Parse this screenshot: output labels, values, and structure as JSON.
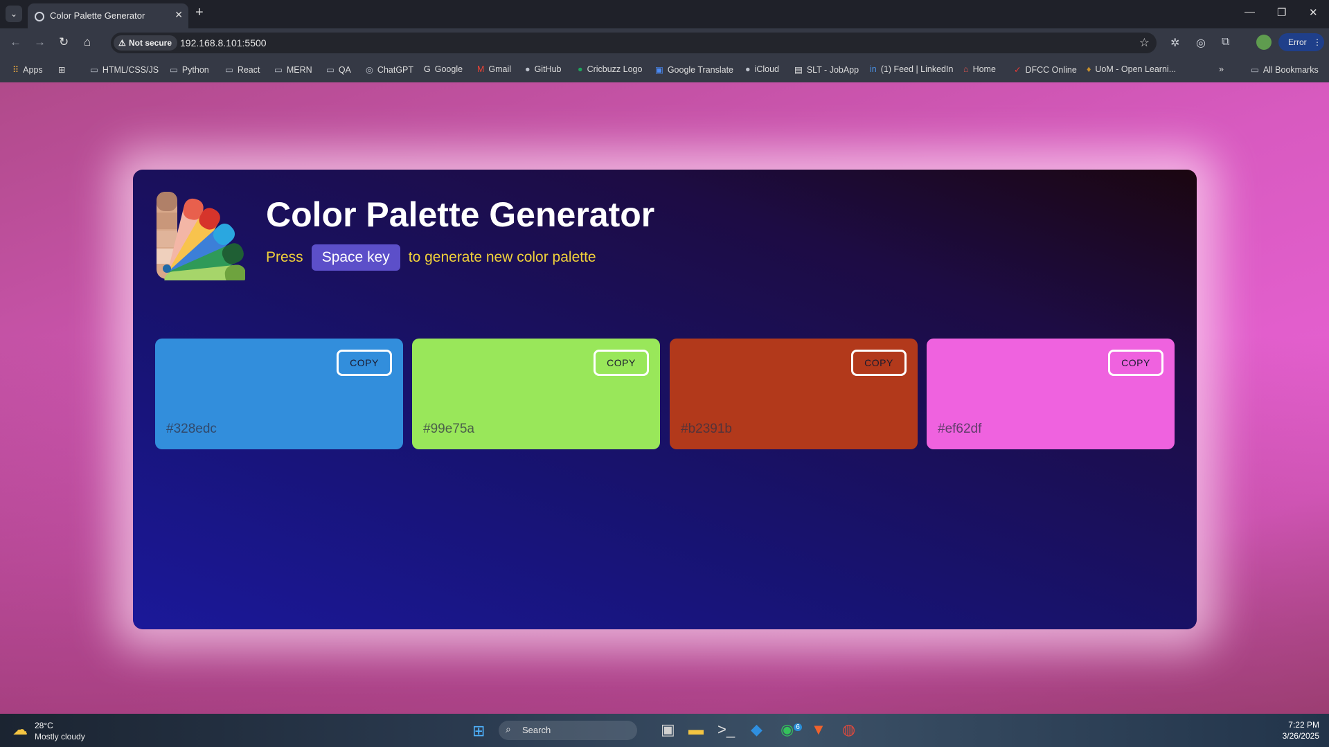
{
  "browser": {
    "tab_title": "Color Palette Generator",
    "new_tab": "+",
    "security_label": "Not secure",
    "url": "192.168.8.101:5500",
    "profile_status": "Error",
    "bookmarks": [
      {
        "label": "Apps",
        "icon": "apps-icon"
      },
      {
        "label": "HTML/CSS/JS",
        "icon": "folder-icon"
      },
      {
        "label": "Python",
        "icon": "folder-icon"
      },
      {
        "label": "React",
        "icon": "folder-icon"
      },
      {
        "label": "MERN",
        "icon": "folder-icon"
      },
      {
        "label": "QA",
        "icon": "folder-icon"
      },
      {
        "label": "ChatGPT",
        "icon": "chatgpt-icon"
      },
      {
        "label": "Google",
        "icon": "google-icon"
      },
      {
        "label": "Gmail",
        "icon": "gmail-icon"
      },
      {
        "label": "GitHub",
        "icon": "github-icon"
      },
      {
        "label": "Cricbuzz Logo",
        "icon": "cricbuzz-icon"
      },
      {
        "label": "Google Translate",
        "icon": "translate-icon"
      },
      {
        "label": "iCloud",
        "icon": "apple-icon"
      },
      {
        "label": "SLT - JobApp",
        "icon": "doc-icon"
      },
      {
        "label": "(1) Feed | LinkedIn",
        "icon": "linkedin-icon"
      },
      {
        "label": "Home",
        "icon": "home-bookmark-icon"
      },
      {
        "label": "DFCC Online",
        "icon": "dfcc-icon"
      },
      {
        "label": "UoM - Open Learni...",
        "icon": "uom-icon"
      }
    ],
    "all_bookmarks": "All Bookmarks"
  },
  "app": {
    "title": "Color Palette Generator",
    "subtitle_pre": "Press",
    "key_label": "Space key",
    "subtitle_post": "to generate new color palette",
    "swatches": [
      {
        "hex": "#328edc",
        "copy_label": "COPY"
      },
      {
        "hex": "#99e75a",
        "copy_label": "COPY"
      },
      {
        "hex": "#b2391b",
        "copy_label": "COPY"
      },
      {
        "hex": "#ef62df",
        "copy_label": "COPY"
      }
    ]
  },
  "taskbar": {
    "temperature": "28°C",
    "condition": "Mostly cloudy",
    "search_label": "Search",
    "whatsapp_badge": "6",
    "time": "7:22 PM",
    "date": "3/26/2025"
  },
  "colors": {
    "accent_badge": "#5c4fc9",
    "subtitle_yellow": "#f2d23a"
  }
}
